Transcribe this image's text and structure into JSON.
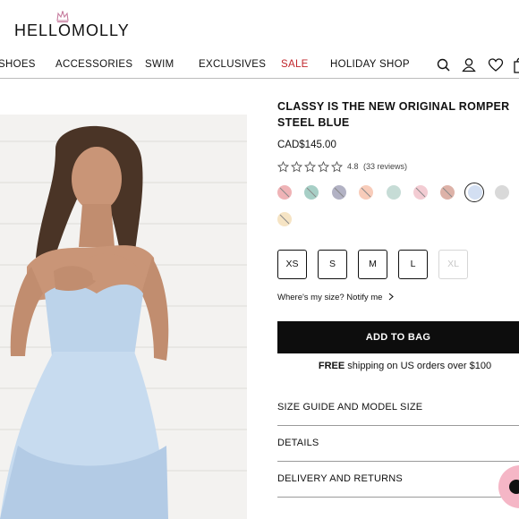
{
  "brand": {
    "logo_text": "HELLOMOLLY"
  },
  "nav": {
    "items": [
      {
        "label": "SHOES"
      },
      {
        "label": "ACCESSORIES"
      },
      {
        "label": "SWIM"
      },
      {
        "label": "EXCLUSIVES"
      },
      {
        "label": "SALE",
        "color": "#c0252b"
      },
      {
        "label": "HOLIDAY SHOP"
      }
    ],
    "icons": [
      "search-icon",
      "account-icon",
      "wishlist-heart-icon",
      "bag-icon"
    ]
  },
  "product": {
    "title": "CLASSY IS THE NEW ORIGINAL ROMPER STEEL BLUE",
    "price": "CAD$145.00",
    "rating": {
      "value": 4.8,
      "display": "4.8",
      "reviews": "(33 reviews)",
      "stars_filled": 0,
      "stars_total": 5
    },
    "swatches": [
      {
        "color": "#efb3b6",
        "unavailable": true
      },
      {
        "color": "#a7cfc6",
        "unavailable": true
      },
      {
        "color": "#b2b2c4",
        "unavailable": true
      },
      {
        "color": "#f8ccba",
        "unavailable": true
      },
      {
        "color": "#c6dcd6",
        "unavailable": false
      },
      {
        "color": "#f3ccd3",
        "unavailable": true
      },
      {
        "color": "#ddb2a8",
        "unavailable": true
      },
      {
        "color": "#d3dff2",
        "unavailable": false,
        "selected": true
      },
      {
        "color": "#d9d9d9",
        "unavailable": false
      },
      {
        "color": "#f6e4c4",
        "unavailable": true
      }
    ],
    "sizes": [
      {
        "label": "XS",
        "available": true
      },
      {
        "label": "S",
        "available": true
      },
      {
        "label": "M",
        "available": true
      },
      {
        "label": "L",
        "available": true
      },
      {
        "label": "XL",
        "available": false
      }
    ],
    "notify_text": "Where's my size? Notify me",
    "add_to_bag": "ADD TO BAG",
    "shipping": {
      "bold": "FREE",
      "rest": " shipping on US orders over $100"
    },
    "accordions": [
      {
        "label": "SIZE GUIDE AND MODEL SIZE"
      },
      {
        "label": "DETAILS"
      },
      {
        "label": "DELIVERY AND RETURNS"
      }
    ]
  },
  "colors": {
    "sale": "#c0252b",
    "button_bg": "#0d0d0d",
    "chat_bubble": "#f5b6c6"
  }
}
